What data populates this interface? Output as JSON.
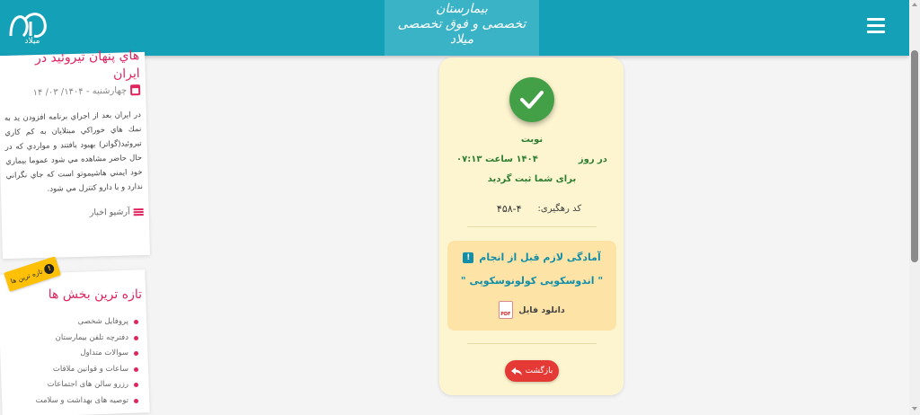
{
  "header": {
    "logo_text": "میلاد",
    "title_line1": "بیمارستان",
    "title_line2": "تخصصی و فوق تخصصی میلاد",
    "menu_icon": "hamburger-icon"
  },
  "sidebar": {
    "news": {
      "title_line1": "هاي پنهان تيروئيد در",
      "title_line2": "ايران",
      "date": "چهارشنبه - ۱۴۰۴/ ۰۳/ ۱۴",
      "body": "در ايران بعد از اجراي برنامه افزودن يد به نمك هاي خوراكي مبتلايان به كم كاري تيروئيد(گواتر) بهبود يافتند و مواردي كه در حال حاضر مشاهده مي شود عموما بيماري خود ايمني هاشيموتو است كه جاي نگراني ندارد و با دارو كنترل مي شود.",
      "archive_label": "آرشیو اخبار"
    },
    "latest": {
      "badge": "تازه ترین ها",
      "title": "تازه ترین بخش ها",
      "items": [
        "پروفایل شخصی",
        "دفترچه تلفن بیمارستان",
        "سوالات متداول",
        "ساعات و قوانین ملاقات",
        "رزرو سالن های اجتماعات",
        "توصیه های بهداشت و سلامت"
      ]
    }
  },
  "appointment": {
    "label": "نوبت",
    "day_prefix": "در روز",
    "date": "۱۴۰۴",
    "time_label": "ساعت",
    "time": "۰۷:۱۳",
    "confirm": "برای شما ثبت گردید",
    "tracking_label": "کد رهگیری:",
    "tracking_code": "۴۵۸-۴",
    "prep_title": "آمادگی لازم قبل از انجام",
    "prep_procedure": "\" اندوسکوپی کولونوسکوپی \"",
    "download_label": "دانلود فایل",
    "back_label": "بازگشت"
  },
  "colors": {
    "header": "#14a1b8",
    "accent_pink": "#e0245e",
    "success_green": "#43a047",
    "card_bg": "#fdf5cf",
    "prep_bg": "#fde3a6",
    "back_red": "#e53935"
  }
}
